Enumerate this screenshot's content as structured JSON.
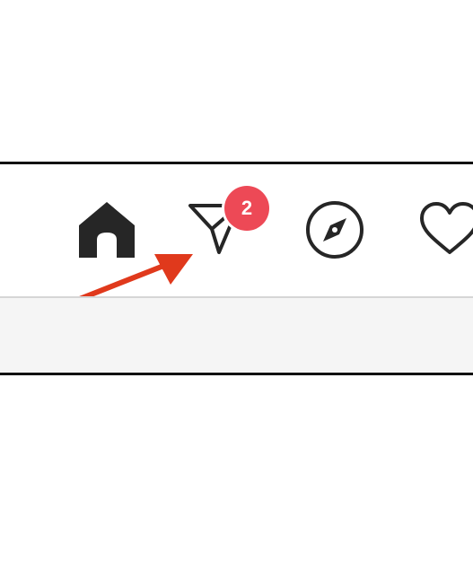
{
  "navbar": {
    "icons": {
      "home": "home-icon",
      "direct": "direct-message-icon",
      "explore": "compass-icon",
      "activity": "heart-icon"
    },
    "direct_badge_count": "2"
  },
  "annotation": {
    "arrow_color": "#e0391c"
  },
  "colors": {
    "badge": "#ed4956",
    "icon": "#262626"
  }
}
